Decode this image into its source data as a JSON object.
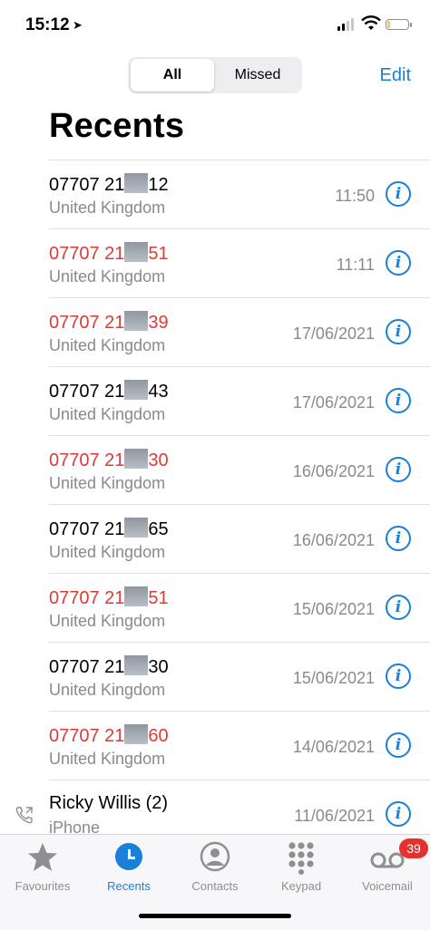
{
  "status": {
    "time": "15:12",
    "location_icon": "location-arrow-icon"
  },
  "header": {
    "tabs": [
      {
        "label": "All"
      },
      {
        "label": "Missed"
      }
    ],
    "edit_label": "Edit",
    "title": "Recents"
  },
  "calls": [
    {
      "prefix": "07707 21",
      "suffix": "12",
      "missed": false,
      "location": "United Kingdom",
      "date": "11:50"
    },
    {
      "prefix": "07707 21",
      "suffix": "51",
      "missed": true,
      "location": "United Kingdom",
      "date": "11:11"
    },
    {
      "prefix": "07707 21",
      "suffix": "39",
      "missed": true,
      "location": "United Kingdom",
      "date": "17/06/2021"
    },
    {
      "prefix": "07707 21",
      "suffix": "43",
      "missed": false,
      "location": "United Kingdom",
      "date": "17/06/2021"
    },
    {
      "prefix": "07707 21",
      "suffix": "30",
      "missed": true,
      "location": "United Kingdom",
      "date": "16/06/2021"
    },
    {
      "prefix": "07707 21",
      "suffix": "65",
      "missed": false,
      "location": "United Kingdom",
      "date": "16/06/2021"
    },
    {
      "prefix": "07707 21",
      "suffix": "51",
      "missed": true,
      "location": "United Kingdom",
      "date": "15/06/2021"
    },
    {
      "prefix": "07707 21",
      "suffix": "30",
      "missed": false,
      "location": "United Kingdom",
      "date": "15/06/2021"
    },
    {
      "prefix": "07707 21",
      "suffix": "60",
      "missed": true,
      "location": "United Kingdom",
      "date": "14/06/2021"
    },
    {
      "prefix": "Ricky Willis (2)",
      "suffix": "",
      "missed": false,
      "location": "iPhone",
      "date": "11/06/2021",
      "outgoing": true
    }
  ],
  "tabbar": {
    "items": [
      {
        "label": "Favourites",
        "icon": "star-icon"
      },
      {
        "label": "Recents",
        "icon": "clock-icon",
        "active": true
      },
      {
        "label": "Contacts",
        "icon": "person-circle-icon"
      },
      {
        "label": "Keypad",
        "icon": "keypad-icon"
      },
      {
        "label": "Voicemail",
        "icon": "voicemail-icon",
        "badge": "39"
      }
    ]
  },
  "colors": {
    "accent": "#1a7fd8",
    "missed": "#e03a35",
    "badge": "#e5322d"
  }
}
